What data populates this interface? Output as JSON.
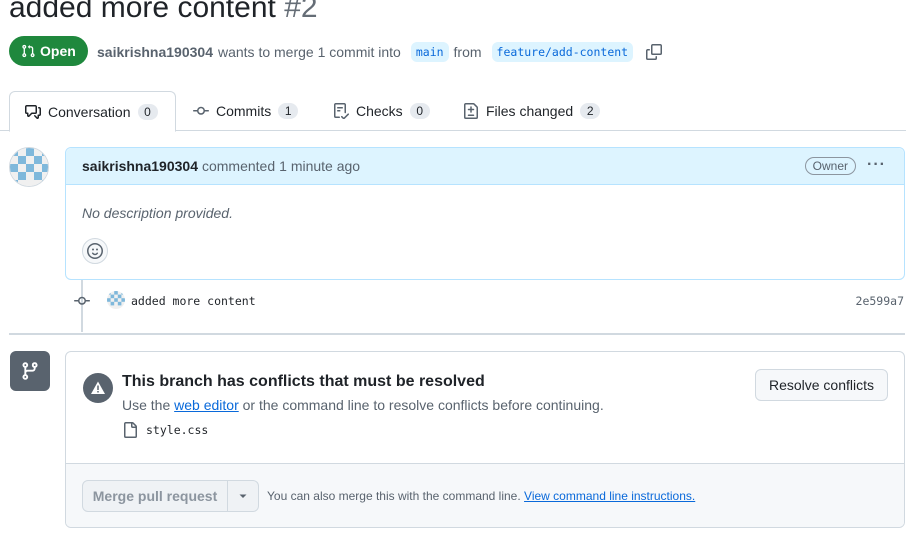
{
  "pr": {
    "title": "added more content",
    "number": "#2",
    "state": "Open",
    "author": "saikrishna190304",
    "merge_text": "wants to merge 1 commit into",
    "base_branch": "main",
    "from_text": "from",
    "head_branch": "feature/add-content"
  },
  "tabs": [
    {
      "label": "Conversation",
      "count": "0"
    },
    {
      "label": "Commits",
      "count": "1"
    },
    {
      "label": "Checks",
      "count": "0"
    },
    {
      "label": "Files changed",
      "count": "2"
    }
  ],
  "comment": {
    "author": "saikrishna190304",
    "action": "commented",
    "time": "1 minute ago",
    "role": "Owner",
    "body": "No description provided."
  },
  "commit": {
    "message": "added more content",
    "sha": "2e599a7"
  },
  "merge": {
    "conflict_title": "This branch has conflicts that must be resolved",
    "desc_prefix": "Use the",
    "desc_link": "web editor",
    "desc_suffix": "or the command line to resolve conflicts before continuing.",
    "conflict_file": "style.css",
    "resolve_label": "Resolve conflicts",
    "merge_label": "Merge pull request",
    "foot_text": "You can also merge this with the command line.",
    "foot_link": "View command line instructions."
  },
  "colors": {
    "open_green": "#1f883d",
    "link_blue": "#0969da",
    "comment_header": "#ddf4ff"
  }
}
